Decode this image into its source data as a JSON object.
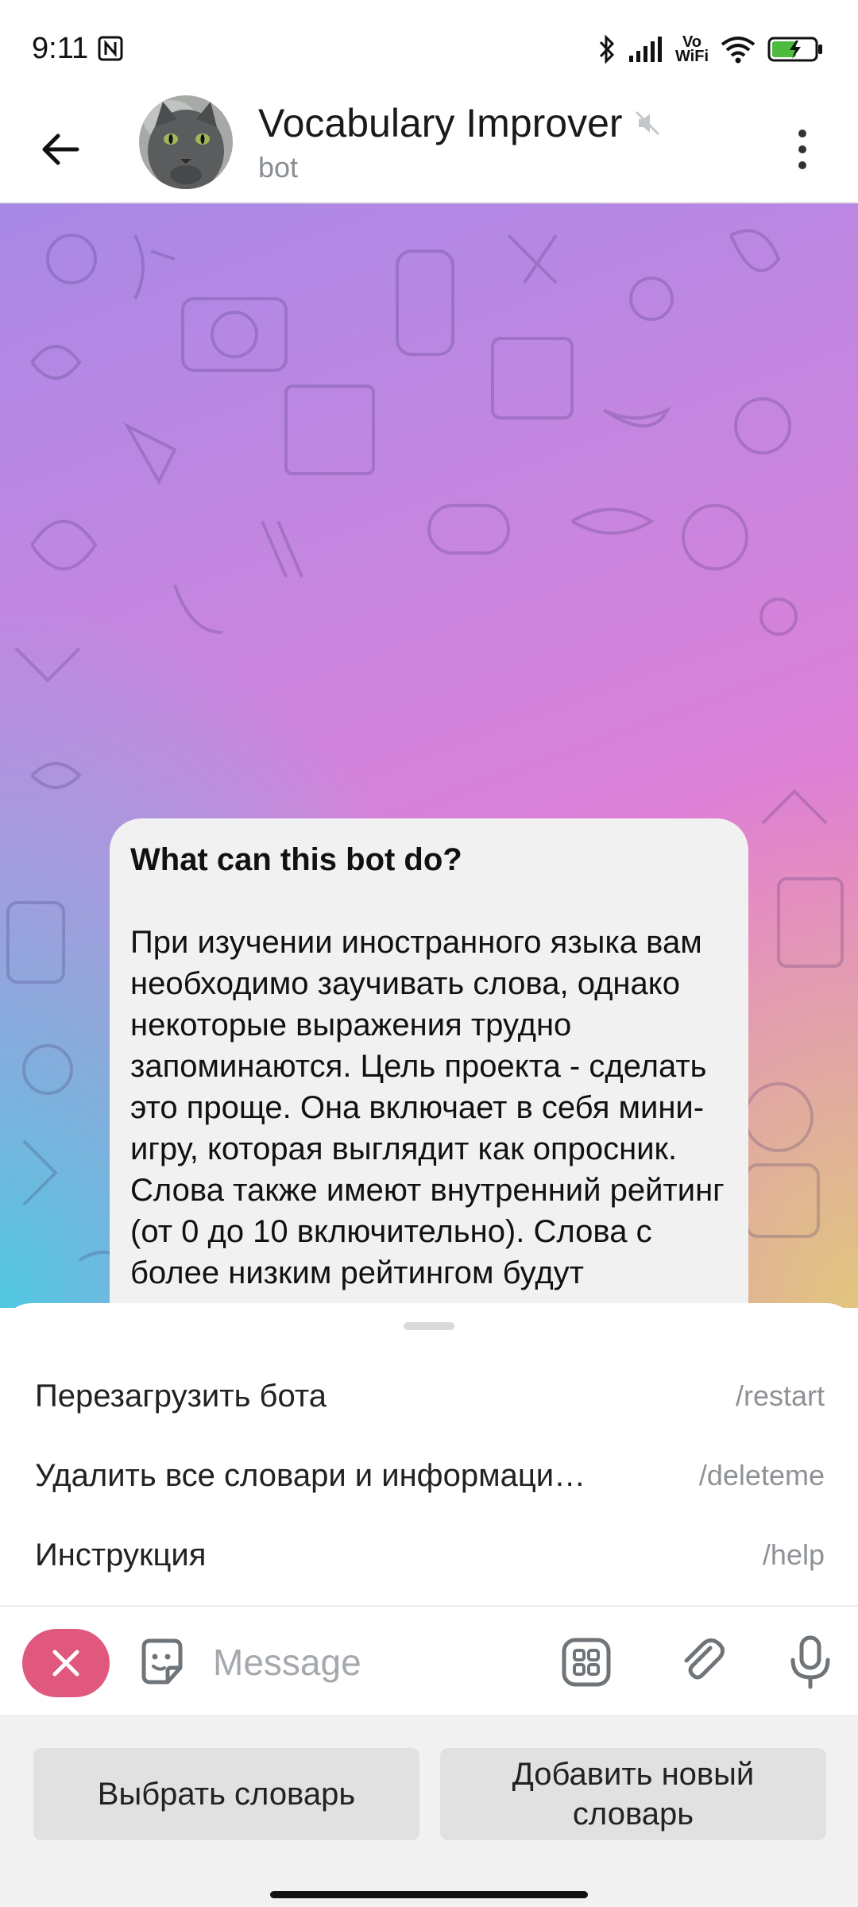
{
  "status_bar": {
    "time": "9:11",
    "volte_line1": "Vo",
    "volte_line2": "WiFi",
    "icons": [
      "nfc-icon",
      "bluetooth-icon",
      "signal-icon",
      "wifi-icon",
      "battery-icon"
    ]
  },
  "header": {
    "title": "Vocabulary Improver",
    "subtitle": "bot"
  },
  "message": {
    "title": "What can this bot do?",
    "text": "При изучении иностранного языка вам необходимо заучивать слова, однако некоторые выражения трудно запоминаются. Цель проекта - сделать это проще. Она включает в себя мини-игру, которая выглядит как опросник. Слова также имеют внутренний рейтинг (от 0 до 10 включительно). Слова с более низким рейтингом будут показываться чаще."
  },
  "commands": [
    {
      "description": "Перезагрузить бота",
      "command": "/restart"
    },
    {
      "description": "Удалить все словари и информаци…",
      "command": "/deleteme"
    },
    {
      "description": "Инструкция",
      "command": "/help"
    }
  ],
  "input": {
    "placeholder": "Message"
  },
  "keyboard": {
    "button1": "Выбрать словарь",
    "button2": "Добавить новый словарь"
  },
  "colors": {
    "accent_close": "#e0587e",
    "bubble": "#f1f1f1",
    "gradient": [
      "#a889e6",
      "#e57dd3",
      "#50c8e1",
      "#e2c878"
    ]
  }
}
